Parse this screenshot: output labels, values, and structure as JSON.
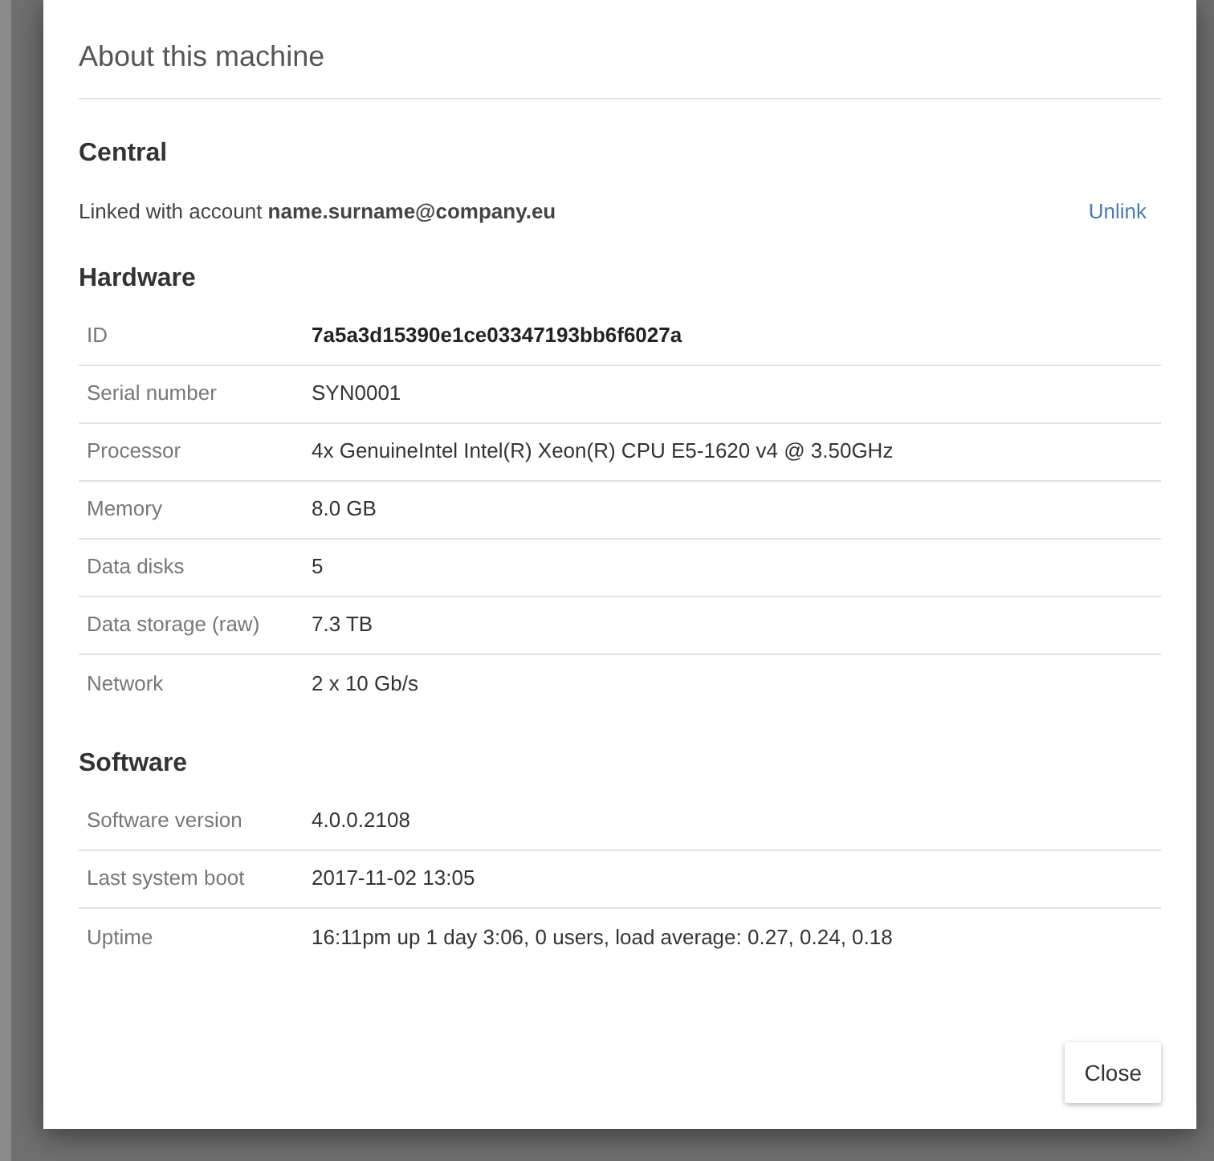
{
  "dialog": {
    "title": "About this machine",
    "central": {
      "heading": "Central",
      "text": "Linked with account **name.surname@company.eu**",
      "link": "Unlink"
    },
    "sections": [
      {
        "heading": "Hardware",
        "rows": [
          {
            "label": "ID",
            "value": "7a5a3d15390e1ce03347193bb6f6027a",
            "emphasized": true
          },
          {
            "label": "Serial number",
            "value": "SYN0001",
            "emphasized": false
          },
          {
            "label": "Processor",
            "value": "4x GenuineIntel Intel(R) Xeon(R) CPU E5-1620 v4 @ 3.50GHz",
            "emphasized": false
          },
          {
            "label": "Memory",
            "value": "8.0 GB",
            "emphasized": false
          },
          {
            "label": "Data disks",
            "value": "5",
            "emphasized": false
          },
          {
            "label": "Data storage (raw)",
            "value": "7.3 TB",
            "emphasized": false
          },
          {
            "label": "Network",
            "value": "2 x 10 Gb/s",
            "emphasized": false
          }
        ]
      },
      {
        "heading": "Software",
        "rows": [
          {
            "label": "Software version",
            "value": "4.0.0.2108",
            "emphasized": false
          },
          {
            "label": "Last system boot",
            "value": "2017-11-02 13:05",
            "emphasized": false
          },
          {
            "label": "Uptime",
            "value": "16:11pm up 1 day 3:06, 0 users, load average: 0.27, 0.24, 0.18",
            "emphasized": false
          }
        ]
      }
    ],
    "buttons": [
      "Close"
    ]
  }
}
